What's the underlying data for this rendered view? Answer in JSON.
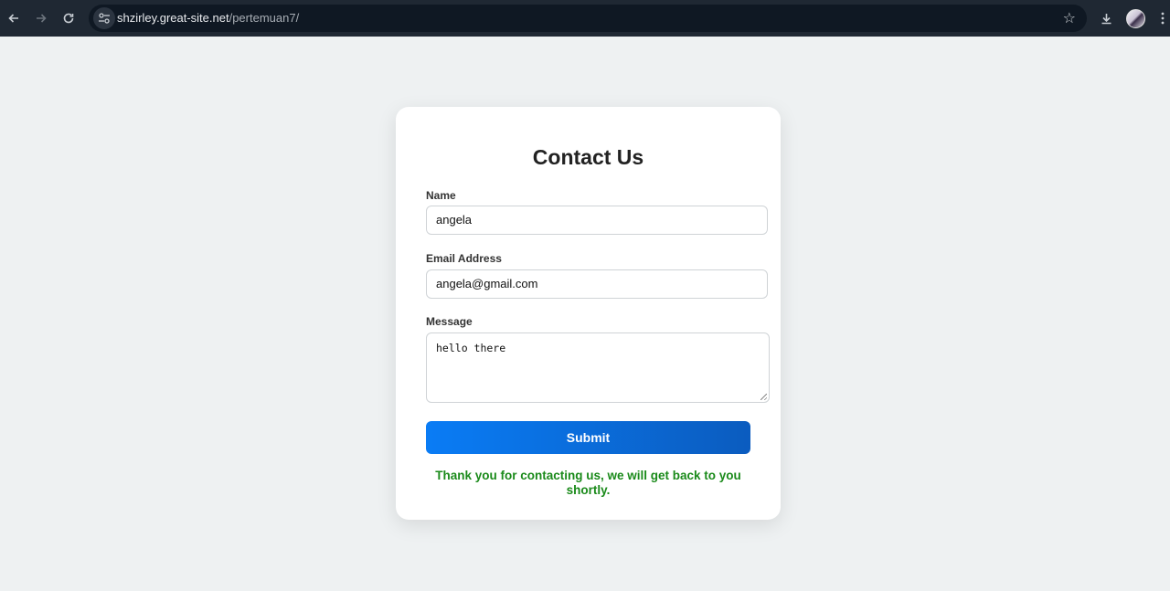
{
  "browser": {
    "url_host": "shzirley.great-site.net",
    "url_path": "/pertemuan7/",
    "icons": {
      "back": "back-arrow-icon",
      "forward": "forward-arrow-icon",
      "reload": "reload-icon",
      "site_info": "site-settings-icon",
      "bookmark": "star-icon",
      "download": "download-icon",
      "menu": "kebab-menu-icon"
    }
  },
  "form": {
    "title": "Contact Us",
    "name_label": "Name",
    "name_value": "angela",
    "email_label": "Email Address",
    "email_value": "angela@gmail.com",
    "message_label": "Message",
    "message_value": "hello there",
    "submit_label": "Submit",
    "success_message": "Thank you for contacting us, we will get back to you shortly."
  },
  "colors": {
    "page_bg": "#eef1f2",
    "button_start": "#0a7cf5",
    "button_end": "#0b5cbf",
    "success": "#1a8a1a"
  }
}
